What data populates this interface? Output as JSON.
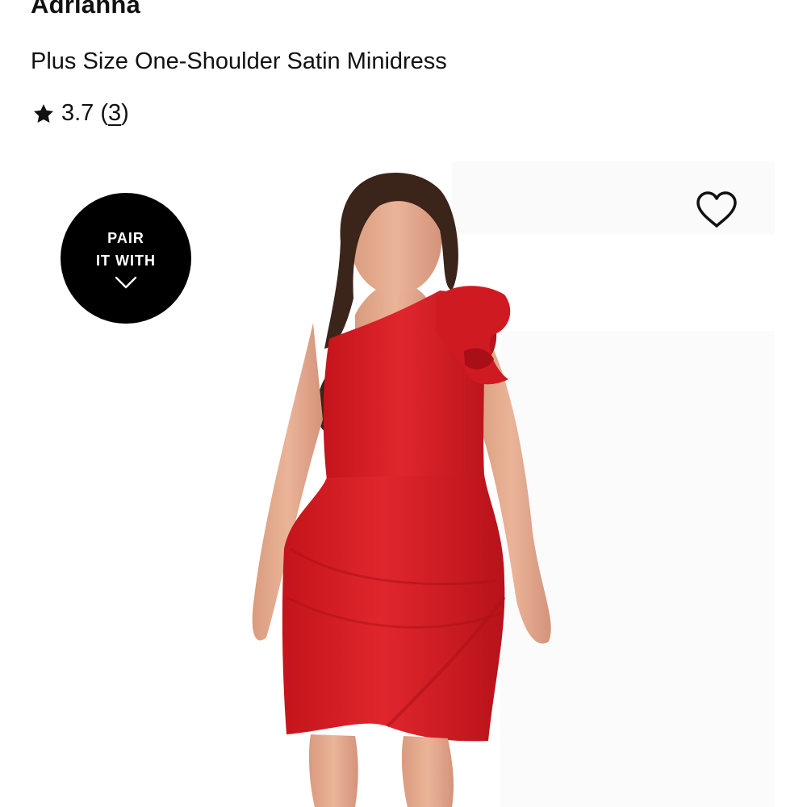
{
  "product": {
    "brand": "Adrianna",
    "title": "Plus Size One-Shoulder Satin Minidress",
    "rating": {
      "value": "3.7",
      "open_paren": "(",
      "count": "3",
      "close_paren": ")"
    }
  },
  "image": {
    "alt": "Model wearing red one-shoulder satin minidress with bow detail",
    "dress_color": "#d91f26"
  },
  "pair_badge": {
    "line1": "PAIR",
    "line2": "IT WITH",
    "icon": "chevron-down-icon"
  },
  "favorite": {
    "icon": "heart-icon",
    "aria": "Add to favorites"
  },
  "colors": {
    "text": "#111111",
    "badge_bg": "#000000"
  }
}
